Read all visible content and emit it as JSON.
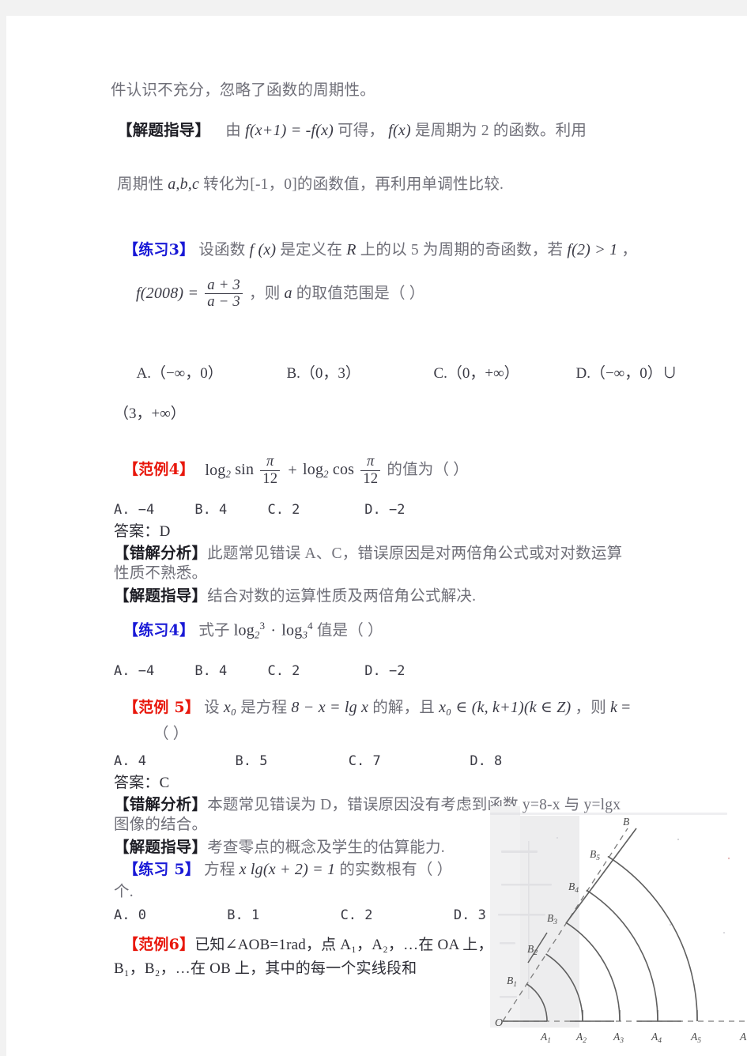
{
  "page": {
    "background": "#ffffff",
    "margin_color": "#f2f2f2"
  },
  "colors": {
    "red_tag": "#e8170c",
    "blue_tag": "#1919d6",
    "body_gray": "#6f6f78",
    "math_ink": "#3b3b46"
  },
  "blocks": {
    "continued_line": "件认识不充分，忽略了函数的周期性。",
    "guide1": {
      "tag": "【解题指导】",
      "text_a": "由",
      "formula": "f(x+1) = -f(x)",
      "text_b": "可得，",
      "fx": "f(x)",
      "text_c": "是周期为 2 的函数。利用",
      "line2_a": "周期性",
      "line2_vars": "a,b,c",
      "line2_b": "转化为[-1，0]的函数值，再利用单调性比较."
    },
    "exercise3": {
      "tag": "【练习3】",
      "text_a": "设函数",
      "fx": "f (x)",
      "text_b": "是定义在",
      "R": "R",
      "text_c": "上的以 5 为周期的奇函数，若",
      "cond": "f(2) > 1",
      "comma": "，",
      "formula_lhs": "f(2008) =",
      "frac_num": "a + 3",
      "frac_den": "a − 3",
      "text_d": "，则",
      "a": "a",
      "text_e": "的取值范围是（        ）",
      "options": [
        "A.（−∞，0）",
        "B.（0，3）",
        "C.（0，+∞）",
        "D.（−∞，0）∪"
      ],
      "options_wrap": "（3，+∞）"
    },
    "example4": {
      "tag": "【范例4】",
      "formula_parts": {
        "log1": "log",
        "base1": "2",
        "sin": "sin",
        "pi": "π",
        "twelve": "12",
        "plus": "+",
        "log2": "log",
        "base2": "2",
        "cos": "cos"
      },
      "text_after": "的值为（        ）",
      "options": "A. −4     B. 4     C. 2        D. −2",
      "answer": "答案：D",
      "wrong_tag": "【错解分析】",
      "wrong_text_1": "此题常见错误 A、C，错误原因是对两倍角公式或对对数运算",
      "wrong_text_2": "性质不熟悉。",
      "guide_tag": "【解题指导】",
      "guide_text": "结合对数的运算性质及两倍角公式解决."
    },
    "exercise4": {
      "tag": "【练习4】",
      "text_a": "式子",
      "log_a": "log",
      "base_a": "2",
      "sup_a": "3",
      "dot": "·",
      "log_b": "log",
      "base_b": "3",
      "sup_b": "4",
      "text_b": "值是（        ）",
      "options": "A. −4     B. 4     C. 2        D. −2"
    },
    "example5": {
      "tag": "【范例 5】",
      "text_a": "设",
      "x0": "x₀",
      "text_b": "是方程",
      "eq": "8 − x = lg x",
      "text_c": "的解，且",
      "member": "x₀ ∈ (k, k+1)(k ∈ Z)",
      "text_d": "，则",
      "k": "k",
      "equals": "=",
      "paren_line": "（        ）",
      "options": "A. 4           B. 5          C. 7           D. 8",
      "answer": "答案：C",
      "wrong_tag": "【错解分析】",
      "wrong_text_1": "本题常见错误为 D，错误原因没有考虑到函数 y=8-x 与 y=lgx",
      "wrong_text_2": "图像的结合。",
      "guide_tag": "【解题指导】",
      "guide_text": "考查零点的概念及学生的估算能力."
    },
    "exercise5": {
      "tag": "【练习 5】",
      "text_a": "方程",
      "eq": "x lg(x + 2) = 1",
      "text_b": "的实数根有（        ）",
      "line2": "个.",
      "options": "A. 0          B. 1          C. 2          D. 3"
    },
    "example6": {
      "tag": "【范例6】",
      "line1": "已知∠AOB=1rad，点 A₁，A₂，…在 OA 上，",
      "line2": "B₁，B₂，…在 OB 上，其中的每一个实线段和"
    }
  },
  "figure": {
    "name": "angle-aob-arcs-diagram",
    "origin_label": "O",
    "ray_a_label": "A",
    "ray_b_label": "B",
    "a_points": [
      "A₁",
      "A₂",
      "A₃",
      "A₄",
      "A₅"
    ],
    "b_points": [
      "B₁",
      "B₂",
      "B₃",
      "B₄",
      "B₅"
    ],
    "angle_radians": 1,
    "arc_count": 5,
    "line_color": "#6a6a6a",
    "scan_tint": "#ececed"
  }
}
